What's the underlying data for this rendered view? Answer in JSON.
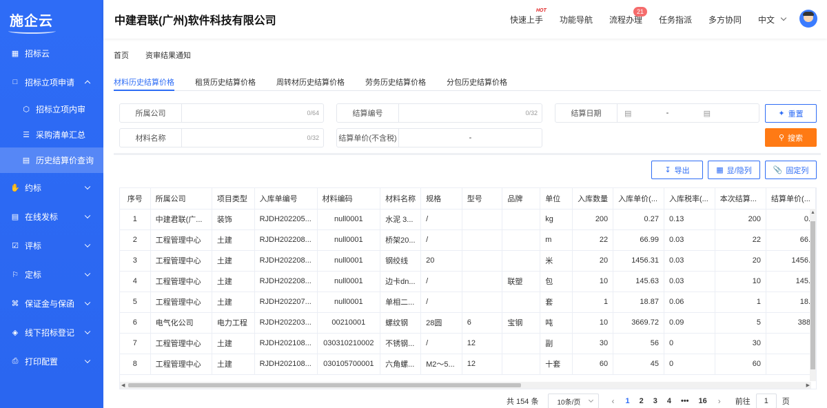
{
  "app": {
    "logo": "施企云",
    "company": "中建君联(广州)软件科技有限公司"
  },
  "header_nav": [
    {
      "label": "快速上手",
      "tag": "HOT"
    },
    {
      "label": "功能导航"
    },
    {
      "label": "流程办理",
      "badge": "21"
    },
    {
      "label": "任务指派"
    },
    {
      "label": "多方协同"
    },
    {
      "label": "中文"
    }
  ],
  "sidebar": {
    "items": [
      {
        "label": "招标云",
        "icon": "grid-icon"
      },
      {
        "label": "招标立项申请",
        "icon": "folder-icon",
        "expanded": true
      },
      {
        "label": "招标立项内审",
        "icon": "cube-icon",
        "sub": true
      },
      {
        "label": "采购清单汇总",
        "icon": "list-icon",
        "sub": true
      },
      {
        "label": "历史结算价查询",
        "icon": "history-icon",
        "sub": true,
        "active": true
      },
      {
        "label": "约标",
        "icon": "hand-icon"
      },
      {
        "label": "在线发标",
        "icon": "doc-icon"
      },
      {
        "label": "评标",
        "icon": "check-icon"
      },
      {
        "label": "定标",
        "icon": "target-icon"
      },
      {
        "label": "保证金与保函",
        "icon": "guarantee-icon"
      },
      {
        "label": "线下招标登记",
        "icon": "register-icon"
      },
      {
        "label": "打印配置",
        "icon": "print-icon"
      }
    ]
  },
  "breadcrumb": [
    "首页",
    "资审结果通知"
  ],
  "tabs": [
    "材料历史结算价格",
    "租赁历史结算价格",
    "周转材历史结算价格",
    "劳务历史结算价格",
    "分包历史结算价格"
  ],
  "filters": {
    "company": {
      "label": "所属公司",
      "count": "0/64"
    },
    "settle_no": {
      "label": "结算编号",
      "count": "0/32"
    },
    "settle_date": {
      "label": "结算日期",
      "sep": "-"
    },
    "material_name": {
      "label": "材料名称",
      "count": "0/32"
    },
    "unit_price": {
      "label": "结算单价(不含税)",
      "sep": "-"
    },
    "reset": "重置",
    "search": "搜索"
  },
  "toolbar": {
    "export": "导出",
    "toggle_cols": "显/隐列",
    "fix_cols": "固定列"
  },
  "table": {
    "columns": [
      "序号",
      "所属公司",
      "项目类型",
      "入库单编号",
      "材料编码",
      "材料名称",
      "规格",
      "型号",
      "品牌",
      "单位",
      "入库数量",
      "入库单价(...",
      "入库税率(...",
      "本次结算...",
      "结算单价(..."
    ],
    "rows": [
      [
        "1",
        "中建君联(广...",
        "装饰",
        "RJDH202205...",
        "null0001",
        "水泥 3...",
        "/",
        "",
        "",
        "kg",
        "200",
        "0.27",
        "0.13",
        "200",
        "0."
      ],
      [
        "2",
        "工程管理中心",
        "土建",
        "RJDH202208...",
        "null0001",
        "桥架20...",
        "/",
        "",
        "",
        "m",
        "22",
        "66.99",
        "0.03",
        "22",
        "66."
      ],
      [
        "3",
        "工程管理中心",
        "土建",
        "RJDH202208...",
        "null0001",
        "钢绞线",
        "20",
        "",
        "",
        "米",
        "20",
        "1456.31",
        "0.03",
        "20",
        "1456."
      ],
      [
        "4",
        "工程管理中心",
        "土建",
        "RJDH202208...",
        "null0001",
        "边卡dn...",
        "/",
        "",
        "联塑",
        "包",
        "10",
        "145.63",
        "0.03",
        "10",
        "145."
      ],
      [
        "5",
        "工程管理中心",
        "土建",
        "RJDH202207...",
        "null0001",
        "单相二...",
        "/",
        "",
        "",
        "套",
        "1",
        "18.87",
        "0.06",
        "1",
        "18."
      ],
      [
        "6",
        "电气化公司",
        "电力工程",
        "RJDH202203...",
        "00210001",
        "螺纹钢",
        "28圆",
        "6",
        "宝钢",
        "吨",
        "10",
        "3669.72",
        "0.09",
        "5",
        "388"
      ],
      [
        "7",
        "工程管理中心",
        "土建",
        "RJDH202108...",
        "030310210002",
        "不锈钢...",
        "/",
        "12",
        "",
        "副",
        "30",
        "56",
        "0",
        "30",
        ""
      ],
      [
        "8",
        "工程管理中心",
        "土建",
        "RJDH202108...",
        "030105700001",
        "六角螺...",
        "M2～5...",
        "12",
        "",
        "十套",
        "60",
        "45",
        "0",
        "60",
        ""
      ]
    ]
  },
  "pagination": {
    "total": "共 154 条",
    "page_size": "10条/页",
    "pages": [
      "1",
      "2",
      "3",
      "4",
      "•••",
      "16"
    ],
    "current": "1",
    "goto_prefix": "前往",
    "goto_value": "1",
    "goto_suffix": "页"
  },
  "colors": {
    "primary": "#2d6cf5",
    "sidebar": "#2e6cf6",
    "search": "#ff7a14",
    "badge": "#f56c6c"
  }
}
